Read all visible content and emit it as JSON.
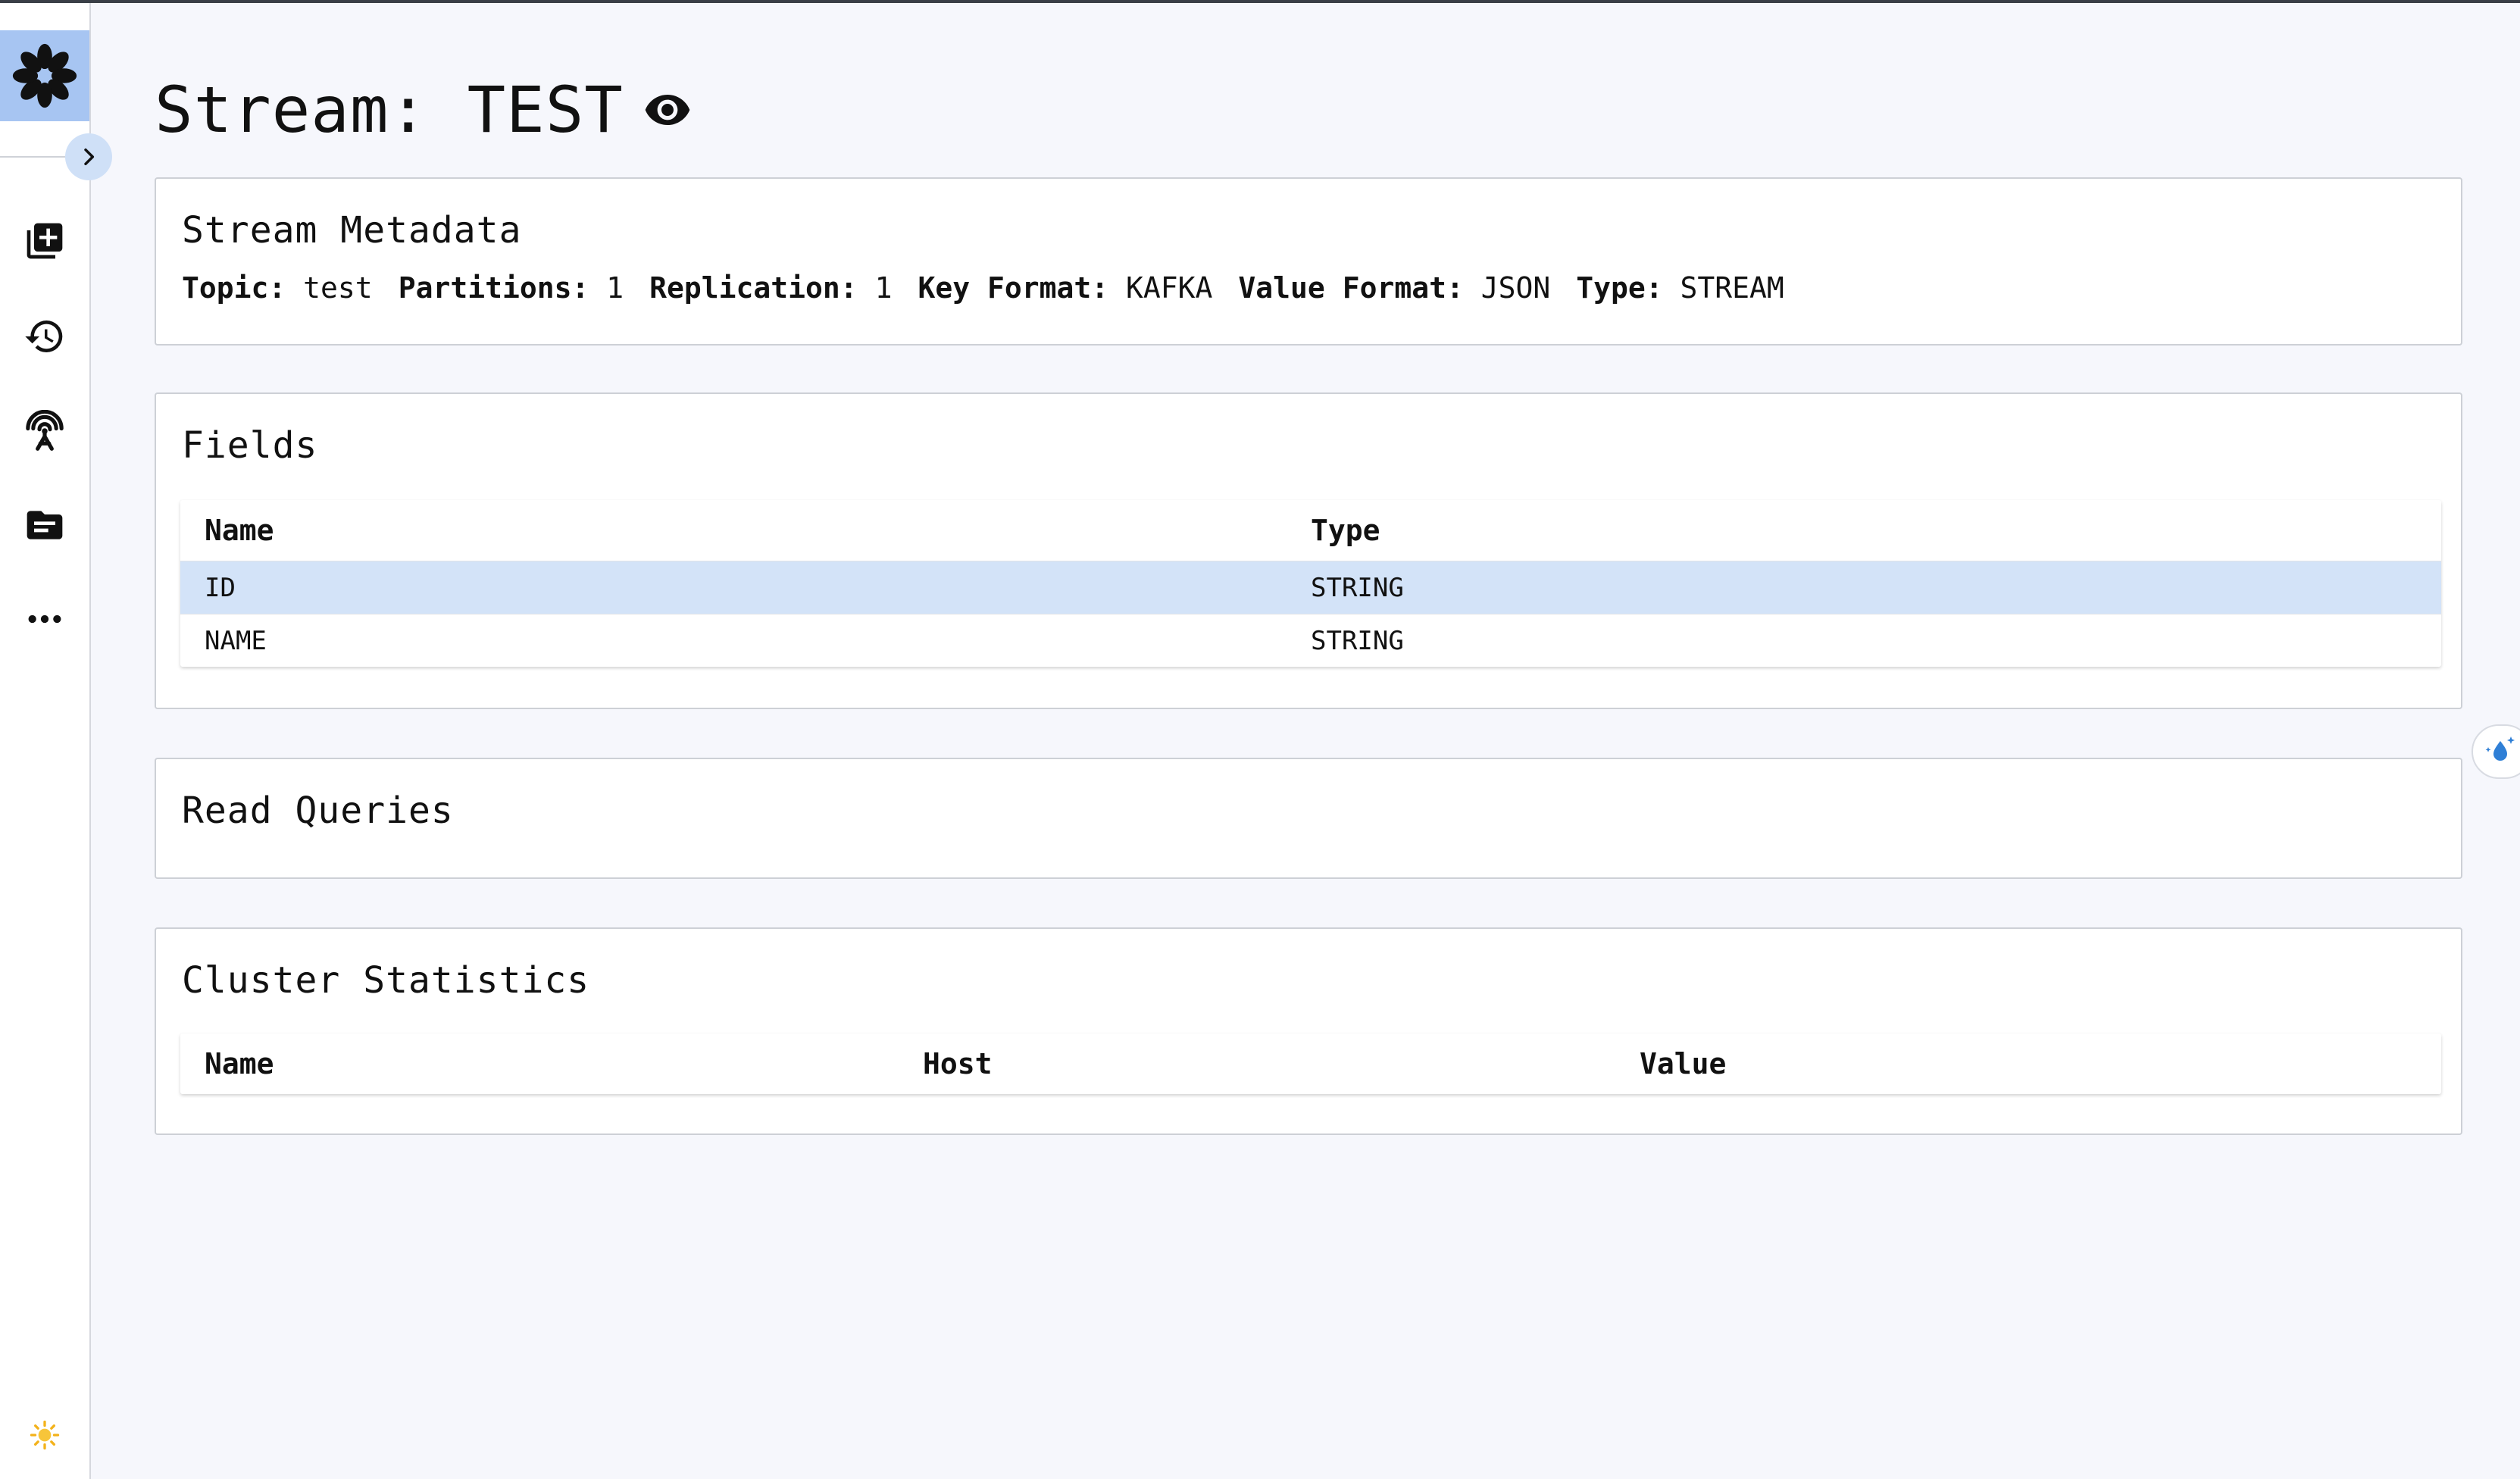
{
  "page": {
    "title": "Stream: TEST"
  },
  "sidebar": {
    "items": [
      {
        "icon": "add-query-icon"
      },
      {
        "icon": "history-icon"
      },
      {
        "icon": "broadcast-icon"
      },
      {
        "icon": "folder-icon"
      },
      {
        "icon": "more-icon"
      }
    ],
    "footer_icon": "sun-icon"
  },
  "metadata": {
    "title": "Stream Metadata",
    "items": [
      {
        "label": "Topic:",
        "value": "test"
      },
      {
        "label": "Partitions:",
        "value": "1"
      },
      {
        "label": "Replication:",
        "value": "1"
      },
      {
        "label": "Key Format:",
        "value": "KAFKA"
      },
      {
        "label": "Value Format:",
        "value": "JSON"
      },
      {
        "label": "Type:",
        "value": "STREAM"
      }
    ]
  },
  "fields": {
    "title": "Fields",
    "columns": [
      "Name",
      "Type"
    ],
    "rows": [
      {
        "name": "ID",
        "type": "STRING",
        "selected": true
      },
      {
        "name": "NAME",
        "type": "STRING",
        "selected": false
      }
    ]
  },
  "read_queries": {
    "title": "Read Queries"
  },
  "cluster_stats": {
    "title": "Cluster Statistics",
    "columns": [
      "Name",
      "Host",
      "Value"
    ]
  },
  "colors": {
    "accent": "#a7c5f2",
    "selected_row": "#d3e3f8",
    "background": "#f6f7fc"
  }
}
